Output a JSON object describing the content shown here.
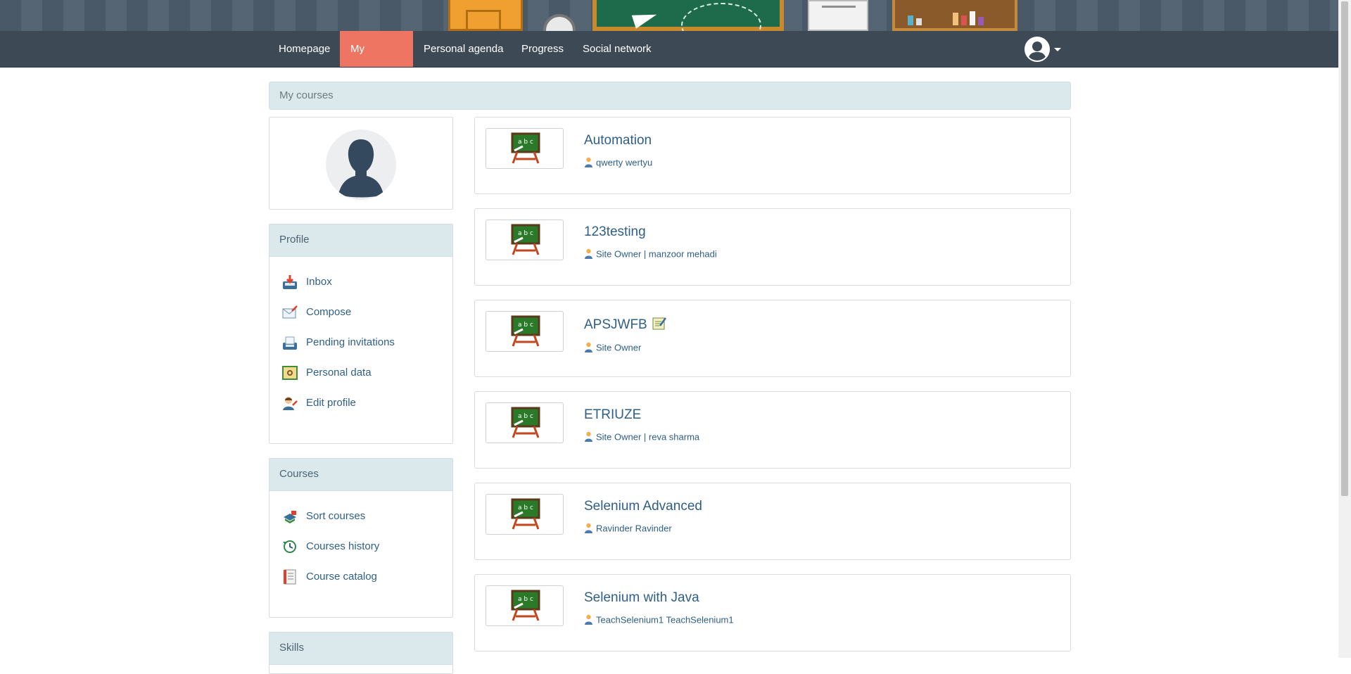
{
  "nav": {
    "items": [
      {
        "label": "Homepage"
      },
      {
        "label": "My courses"
      },
      {
        "label": "Personal agenda"
      },
      {
        "label": "Progress"
      },
      {
        "label": "Social network"
      }
    ],
    "active_item": "My courses",
    "user_menu_icon": "user-avatar-icon"
  },
  "breadcrumb": {
    "current": "My courses"
  },
  "profile_panel": {
    "title": "Profile",
    "items": [
      {
        "label": "Inbox",
        "icon": "inbox-icon"
      },
      {
        "label": "Compose",
        "icon": "compose-icon"
      },
      {
        "label": "Pending invitations",
        "icon": "invitations-icon"
      },
      {
        "label": "Personal data",
        "icon": "personal-data-icon"
      },
      {
        "label": "Edit profile",
        "icon": "edit-profile-icon"
      }
    ]
  },
  "courses_panel": {
    "title": "Courses",
    "items": [
      {
        "label": "Sort courses",
        "icon": "sort-courses-icon"
      },
      {
        "label": "Courses history",
        "icon": "history-icon"
      },
      {
        "label": "Course catalog",
        "icon": "catalog-icon"
      }
    ]
  },
  "skills_panel": {
    "title": "Skills"
  },
  "courses": [
    {
      "title": "Automation",
      "teacher": "qwerty wertyu"
    },
    {
      "title": "123testing",
      "teacher": "Site Owner | manzoor mehadi"
    },
    {
      "title": "APSJWFB",
      "teacher": "Site Owner"
    },
    {
      "title": "ETRIUZE",
      "teacher": "Site Owner | reva sharma"
    },
    {
      "title": "Selenium Advanced",
      "teacher": "Ravinder Ravinder"
    },
    {
      "title": "Selenium with Java",
      "teacher": "TeachSelenium1 TeachSelenium1"
    }
  ],
  "colors": {
    "navbar": "#3d4a56",
    "nav_active": "#ee7561",
    "panel_header": "#dbe9ec",
    "link": "#2f5f86"
  }
}
